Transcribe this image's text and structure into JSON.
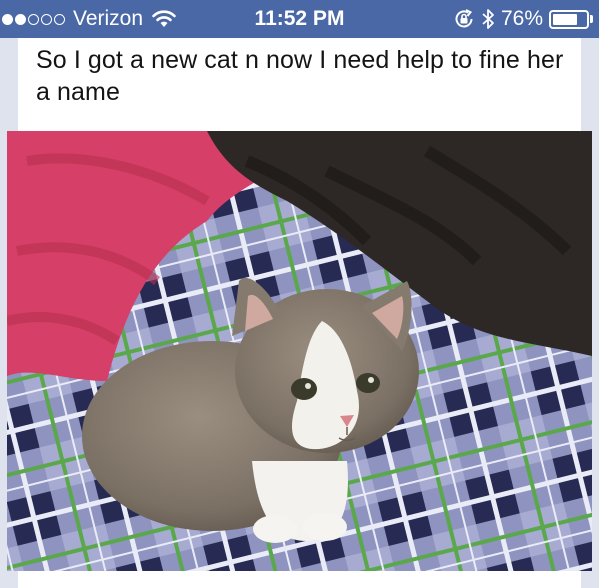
{
  "status_bar": {
    "carrier": "Verizon",
    "signal_bars_filled": 2,
    "signal_bars_total": 5,
    "time": "11:52 PM",
    "battery_percent": "76%",
    "battery_level": 0.76,
    "icons": [
      "signal-dots-icon",
      "wifi-icon",
      "rotation-lock-icon",
      "bluetooth-icon",
      "battery-icon"
    ]
  },
  "post": {
    "text": "So I got a new cat n now I need  help to fine her a name"
  },
  "photo": {
    "icon": "kitten-photo"
  },
  "colors": {
    "status_bar": "#4a68a6",
    "feed_background": "#dfe3ee",
    "card_background": "#ffffff"
  }
}
